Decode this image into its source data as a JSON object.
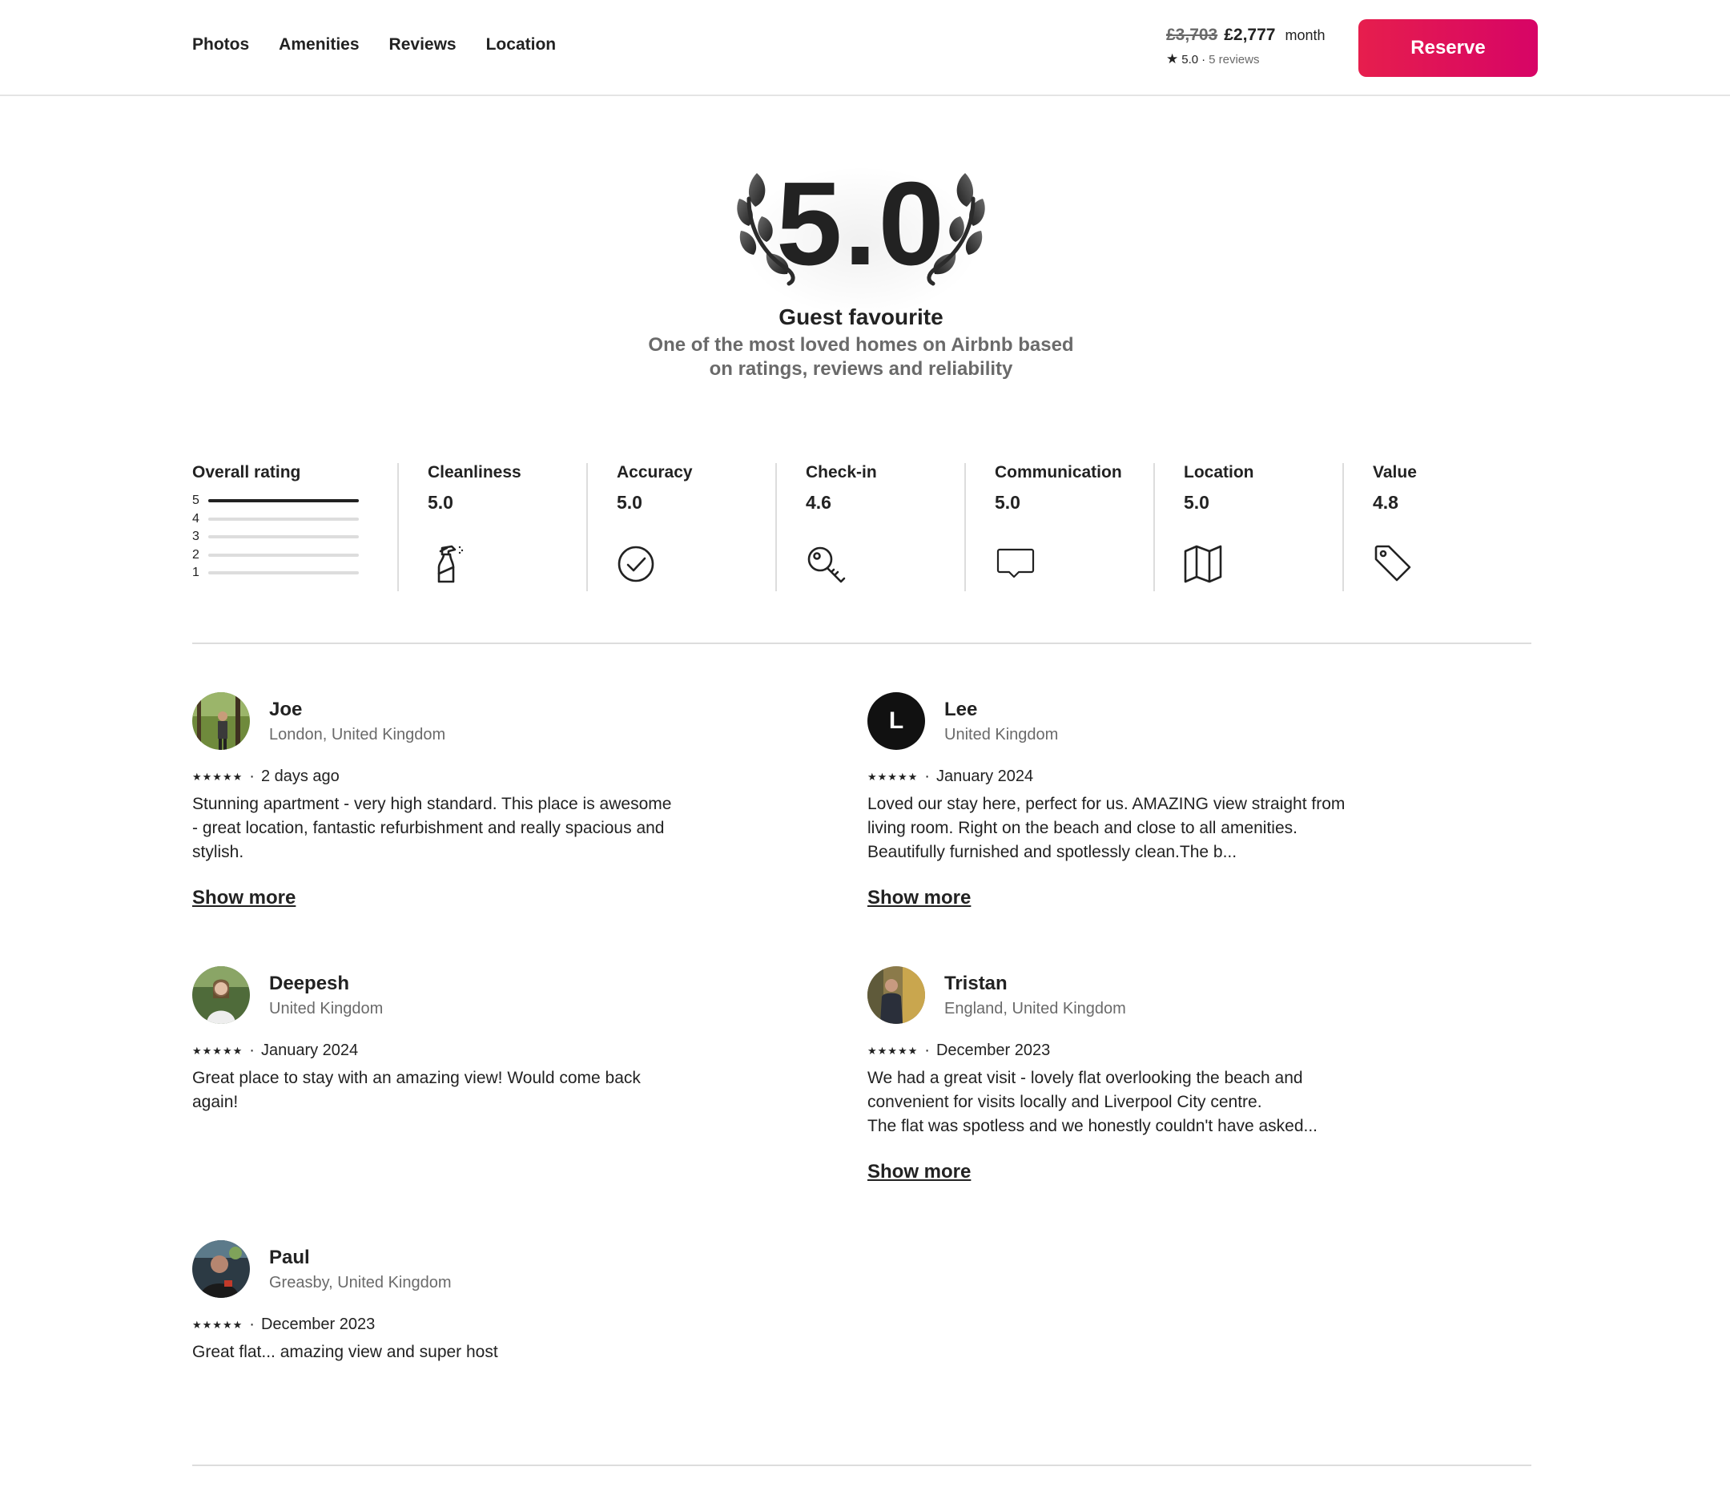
{
  "nav": {
    "items": [
      "Photos",
      "Amenities",
      "Reviews",
      "Location"
    ]
  },
  "price": {
    "old": "£3,703",
    "new": "£2,777",
    "unit": "month",
    "rating": "5.0",
    "dot": "·",
    "reviews": "5 reviews",
    "reserve_label": "Reserve"
  },
  "colors": {
    "accent_start": "#e61e4d",
    "accent_end": "#d70466",
    "text": "#222222",
    "muted": "#6a6a6a",
    "divider": "#dddddd"
  },
  "guest_favourite": {
    "score": "5.0",
    "title": "Guest favourite",
    "subtitle_line1": "One of the most loved homes on Airbnb based",
    "subtitle_line2": "on ratings, reviews and reliability"
  },
  "overall_rating": {
    "label": "Overall rating",
    "bars": [
      {
        "stars": "5",
        "fraction": 1.0
      },
      {
        "stars": "4",
        "fraction": 0.0
      },
      {
        "stars": "3",
        "fraction": 0.0
      },
      {
        "stars": "2",
        "fraction": 0.0
      },
      {
        "stars": "1",
        "fraction": 0.0
      }
    ]
  },
  "categories": [
    {
      "label": "Cleanliness",
      "value": "5.0",
      "icon": "spray-bottle-icon"
    },
    {
      "label": "Accuracy",
      "value": "5.0",
      "icon": "check-circle-icon"
    },
    {
      "label": "Check-in",
      "value": "4.6",
      "icon": "key-icon"
    },
    {
      "label": "Communication",
      "value": "5.0",
      "icon": "chat-bubble-icon"
    },
    {
      "label": "Location",
      "value": "5.0",
      "icon": "map-icon"
    },
    {
      "label": "Value",
      "value": "4.8",
      "icon": "tag-icon"
    }
  ],
  "reviews": [
    {
      "name": "Joe",
      "location": "London, United Kingdom",
      "stars": "★★★★★",
      "dot": "·",
      "date": "2 days ago",
      "text": "Stunning apartment - very high standard. This place is awesome - great location, fantastic refurbishment and really spacious and stylish.",
      "show_more": "Show more"
    },
    {
      "name": "Lee",
      "initial": "L",
      "location": "United Kingdom",
      "stars": "★★★★★",
      "dot": "·",
      "date": "January 2024",
      "text": "Loved our stay here, perfect for us. AMAZING view straight from living room. Right on the beach and close to all amenities. Beautifully furnished and spotlessly clean.The b...",
      "show_more": "Show more"
    },
    {
      "name": "Deepesh",
      "location": "United Kingdom",
      "stars": "★★★★★",
      "dot": "·",
      "date": "January 2024",
      "text": "Great place to stay with an amazing view! Would come back again!"
    },
    {
      "name": "Tristan",
      "location": "England, United Kingdom",
      "stars": "★★★★★",
      "dot": "·",
      "date": "December 2023",
      "text_line1": "We had a great visit - lovely flat overlooking the beach and convenient for visits locally and Liverpool City centre.",
      "text_line2": "The flat was spotless and we honestly couldn't have asked...",
      "show_more": "Show more"
    },
    {
      "name": "Paul",
      "location": "Greasby, United Kingdom",
      "stars": "★★★★★",
      "dot": "·",
      "date": "December 2023",
      "text": "Great flat... amazing view and super host"
    }
  ]
}
